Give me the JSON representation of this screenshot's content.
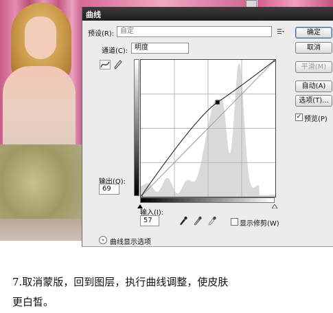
{
  "dialog": {
    "title": "曲线",
    "preset": {
      "label": "预设(R):",
      "value": "自定"
    },
    "channel": {
      "label": "通道(C):",
      "value": "明度"
    },
    "output": {
      "label": "输出(O):",
      "value": "69"
    },
    "input": {
      "label": "输入(I):",
      "value": "57"
    },
    "show_clipping": {
      "label": "显示修剪(W)",
      "checked": false
    },
    "curve_display_options": "曲线显示选项",
    "buttons": {
      "ok": "确定",
      "cancel": "取消",
      "smooth": "平滑(M)",
      "auto": "自动(A)",
      "options": "选项(T)..."
    },
    "preview": {
      "label": "预览(P)",
      "checked": true
    }
  },
  "curve": {
    "points": [
      [
        0,
        0
      ],
      [
        57,
        69
      ],
      [
        100,
        100
      ]
    ],
    "range": [
      0,
      100
    ]
  },
  "caption": {
    "line1": "7.取消蒙版，回到图层，执行曲线调整，使皮肤",
    "line2": "更白皙。"
  }
}
